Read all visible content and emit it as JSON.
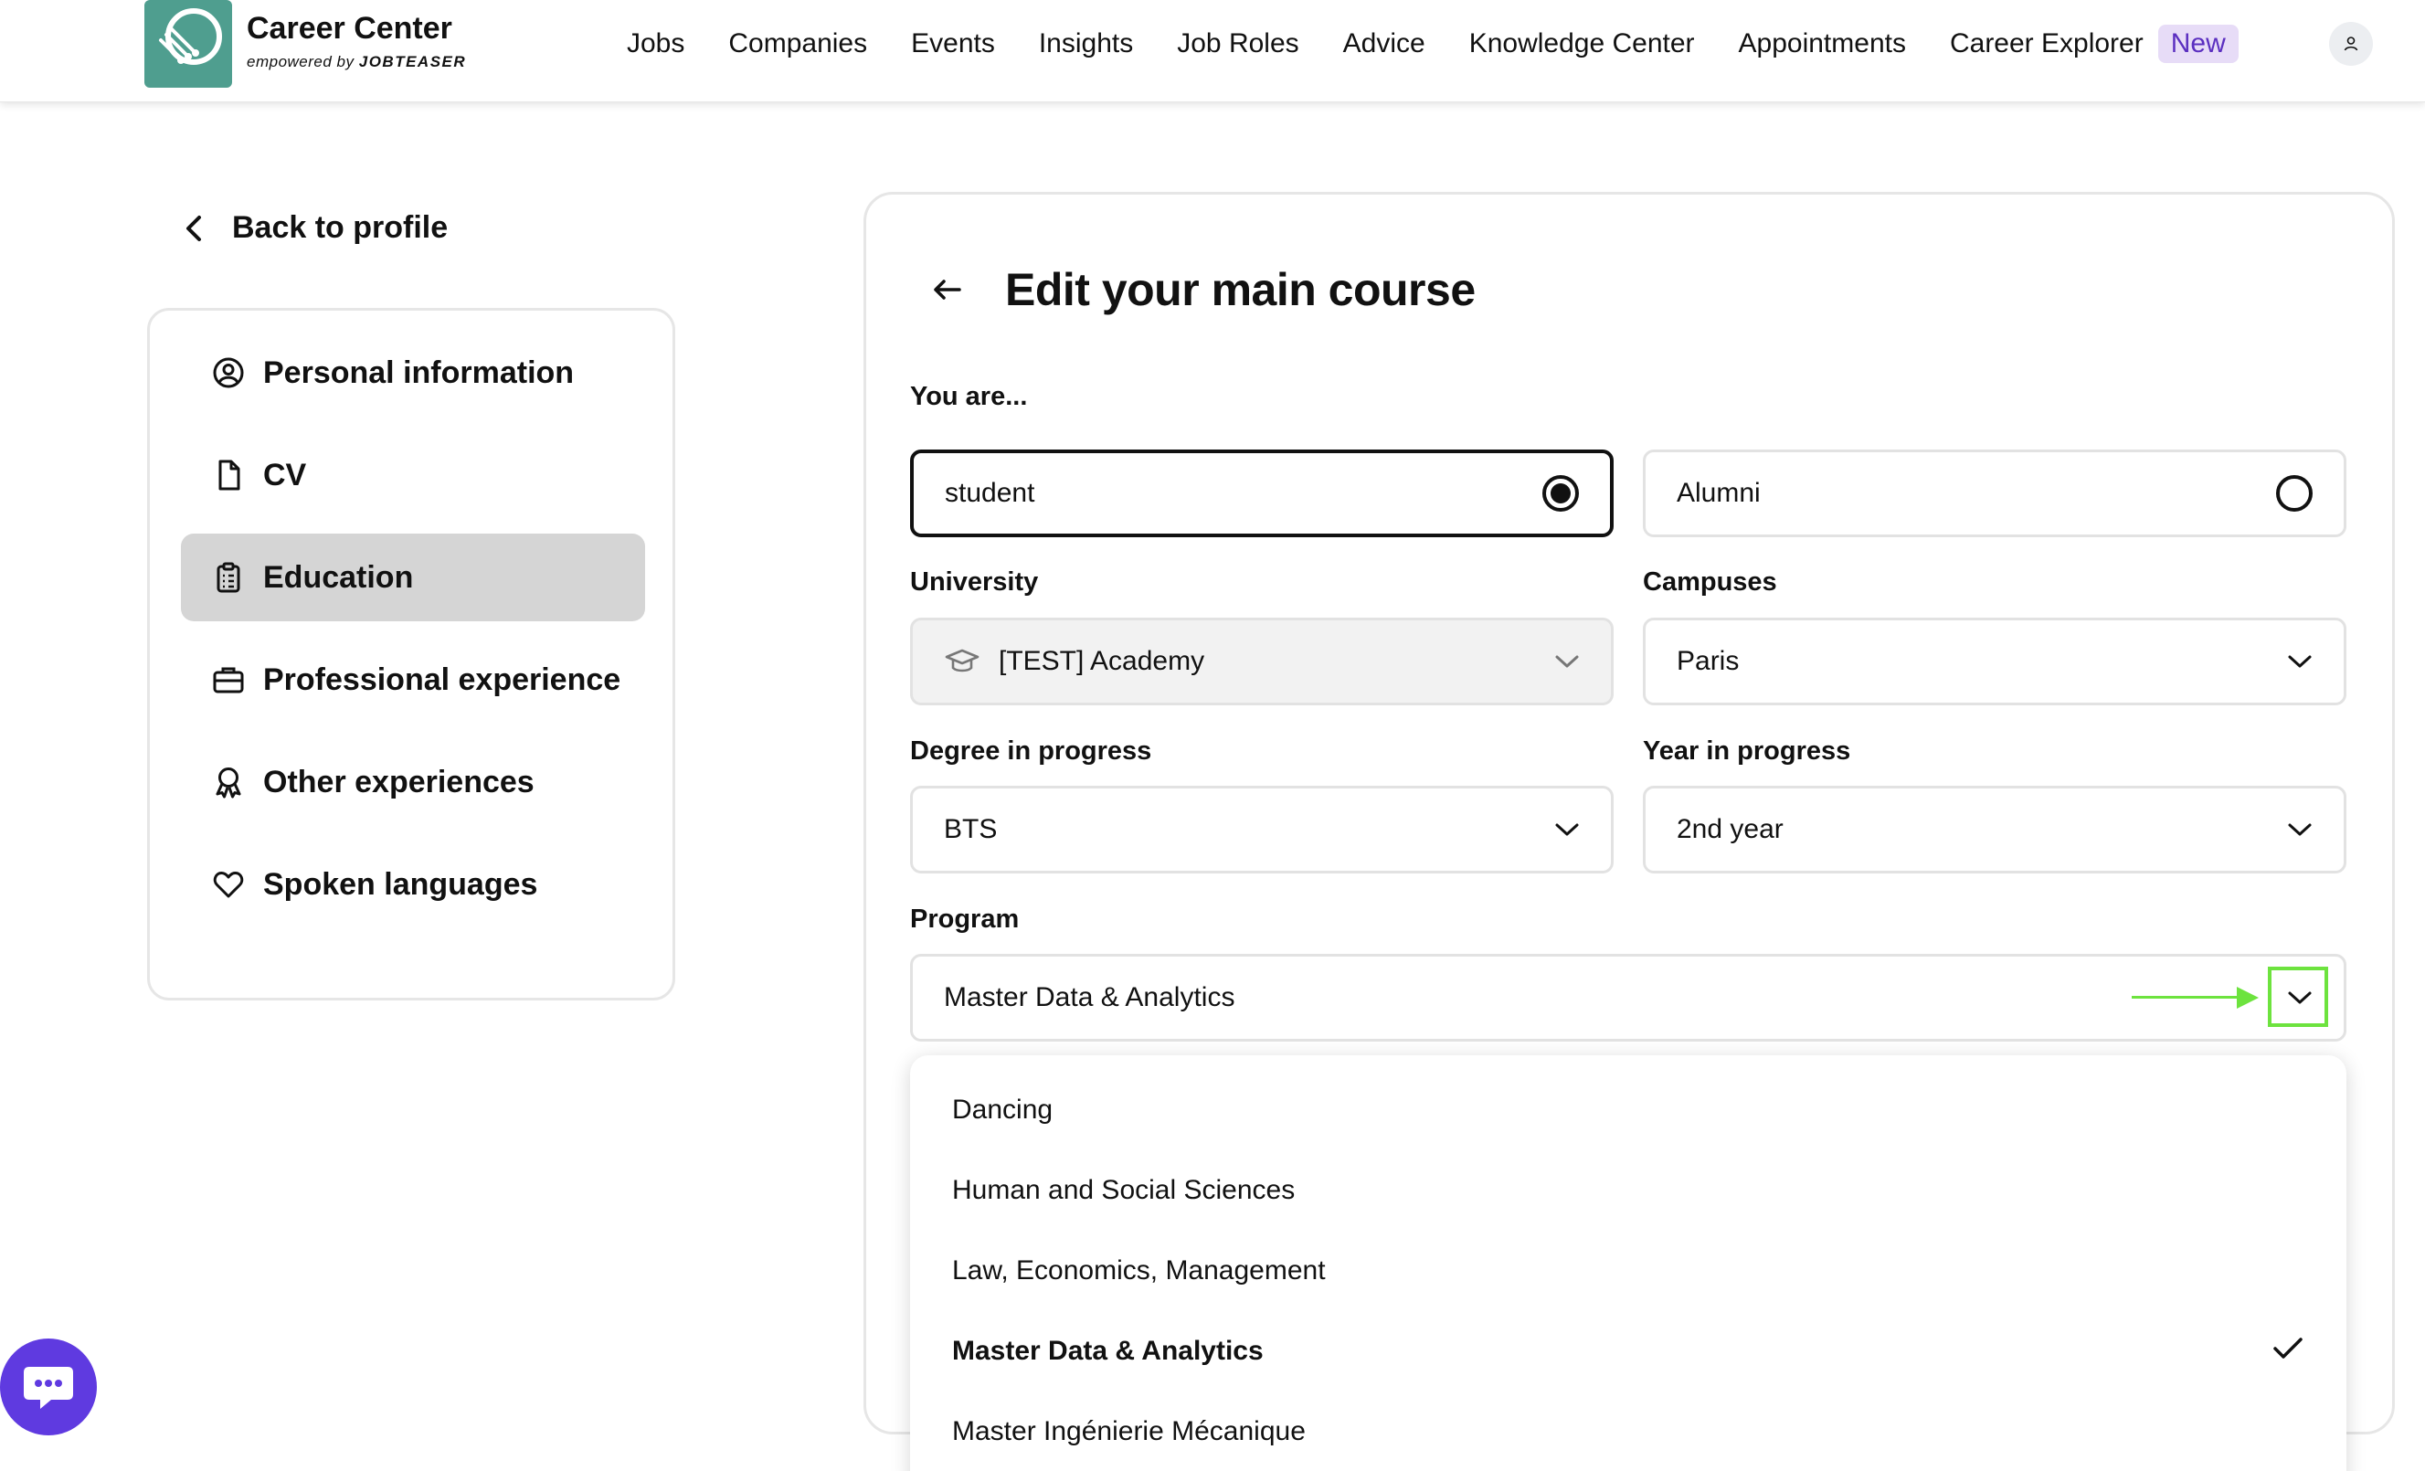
{
  "header": {
    "brand_title": "Career Center",
    "brand_sub_prefix": "empowered by",
    "brand_sub_name": "JOBTEASER",
    "nav": [
      "Jobs",
      "Companies",
      "Events",
      "Insights",
      "Job Roles",
      "Advice",
      "Knowledge Center",
      "Appointments",
      "Career Explorer"
    ],
    "new_badge": "New",
    "badge_color": "#e7dcf7"
  },
  "sidebar": {
    "back_label": "Back to profile",
    "items": [
      {
        "label": "Personal information",
        "icon": "user-circle-icon"
      },
      {
        "label": "CV",
        "icon": "document-icon"
      },
      {
        "label": "Education",
        "icon": "clipboard-icon",
        "active": true
      },
      {
        "label": "Professional experience",
        "icon": "briefcase-icon"
      },
      {
        "label": "Other experiences",
        "icon": "award-icon"
      },
      {
        "label": "Spoken languages",
        "icon": "heart-icon"
      }
    ]
  },
  "form": {
    "title": "Edit your main course",
    "you_are_label": "You are...",
    "status_options": [
      "student",
      "Alumni"
    ],
    "status_selected": "student",
    "university_label": "University",
    "university_value": "[TEST] Academy",
    "campuses_label": "Campuses",
    "campuses_value": "Paris",
    "degree_label": "Degree in progress",
    "degree_value": "BTS",
    "year_label": "Year in progress",
    "year_value": "2nd year",
    "program_label": "Program",
    "program_value": "Master Data & Analytics"
  },
  "program_dropdown": {
    "options": [
      "Dancing",
      "Human and Social Sciences",
      "Law, Economics, Management",
      "Master Data & Analytics",
      "Master Ingénierie Mécanique"
    ],
    "selected": "Master Data & Analytics"
  },
  "colors": {
    "accent": "#5f3ae0",
    "logo": "#4f9e8f",
    "annotation": "#6de33e"
  }
}
